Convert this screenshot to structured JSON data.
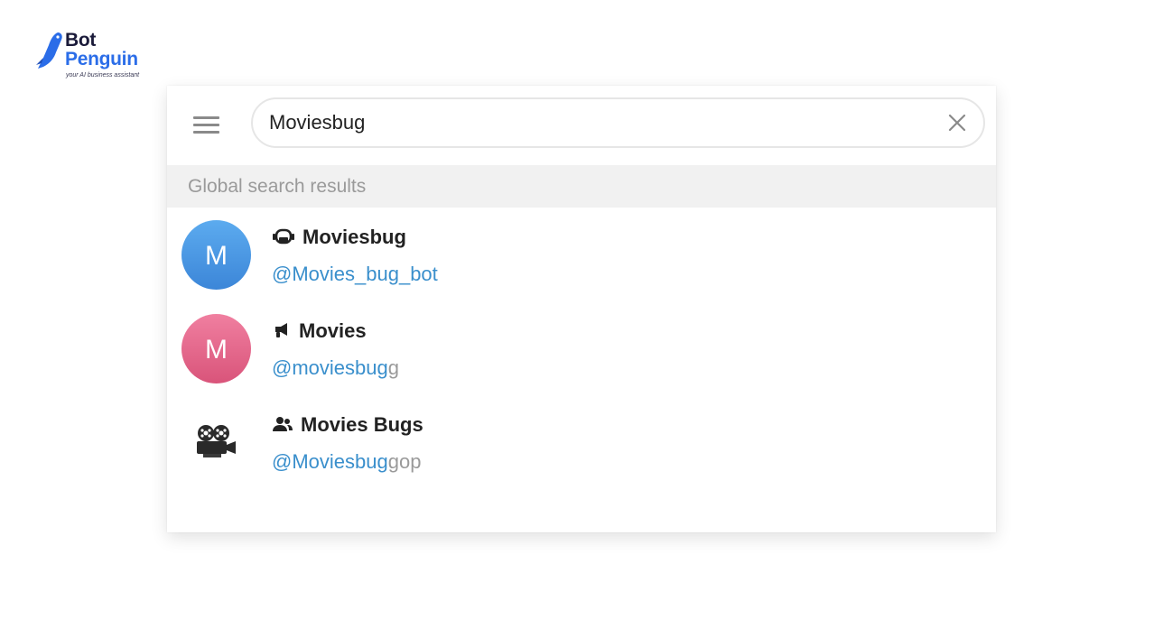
{
  "brand": {
    "name_line1": "Bot",
    "name_line2": "Penguin",
    "tagline": "your AI business assistant"
  },
  "search": {
    "menu_icon": "hamburger-menu-icon",
    "value": "Moviesbug",
    "clear_icon": "close-icon"
  },
  "section": {
    "title": "Global search results"
  },
  "results": [
    {
      "avatar_letter": "M",
      "avatar_color": "#4a97e4",
      "type_icon": "bot-icon",
      "title": "Moviesbug",
      "handle_match": "@Movies_bug_bot",
      "handle_rest": ""
    },
    {
      "avatar_letter": "M",
      "avatar_color": "#e56a8e",
      "type_icon": "channel-megaphone-icon",
      "title": "Movies",
      "handle_match": "@moviesbug",
      "handle_rest": "g"
    },
    {
      "avatar_image": "movie-projector-icon",
      "type_icon": "group-icon",
      "title": "Movies Bugs",
      "handle_match": "@Moviesbug",
      "handle_rest": "gop"
    }
  ],
  "colors": {
    "link": "#3a8fcc",
    "muted": "#9a9a9a",
    "section_bg": "#f1f1f1"
  }
}
